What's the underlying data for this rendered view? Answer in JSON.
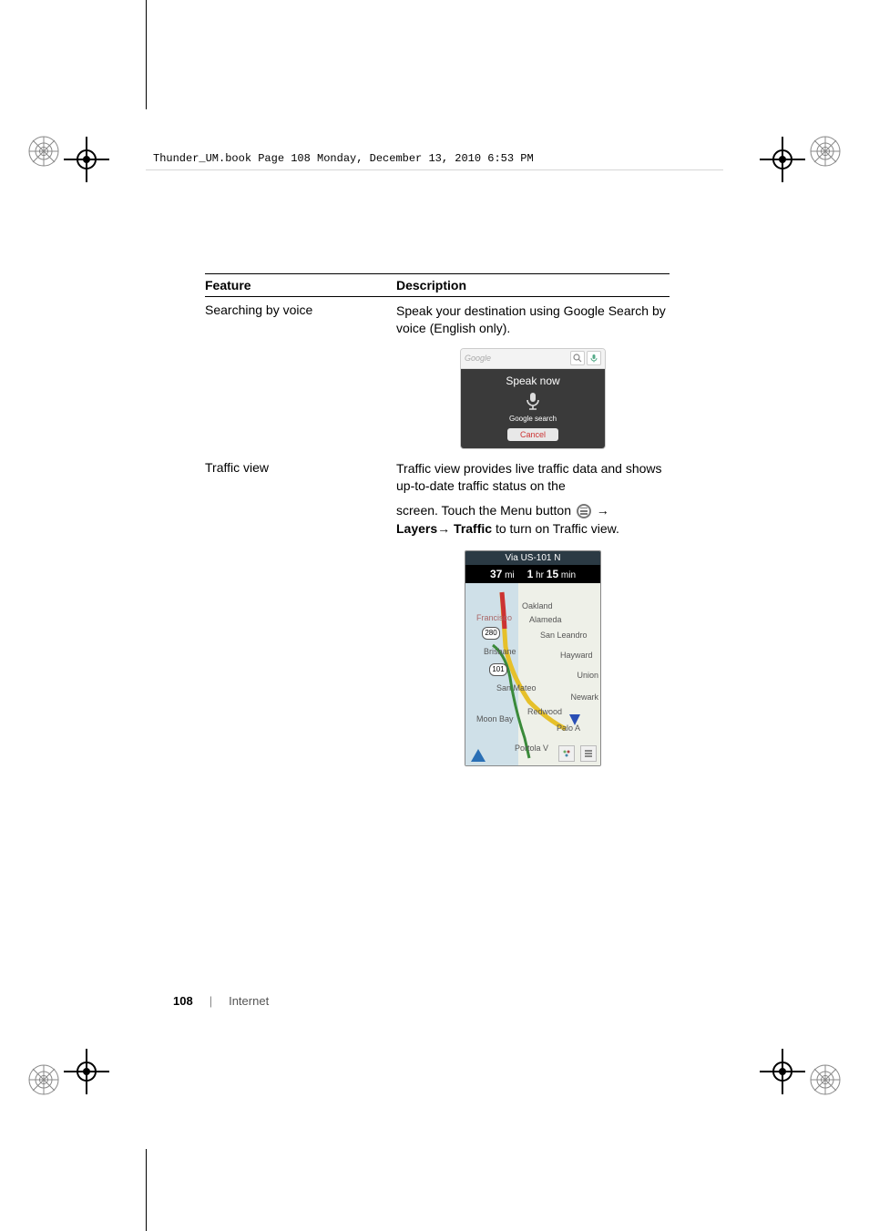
{
  "running_header": "Thunder_UM.book  Page 108  Monday, December 13, 2010  6:53 PM",
  "table": {
    "head_feature": "Feature",
    "head_desc": "Description",
    "rows": [
      {
        "feature": "Searching by voice",
        "desc_line1": "Speak your destination using Google Search by voice (English only).",
        "voice": {
          "placeholder": "Google",
          "title": "Speak now",
          "subtitle": "Google search",
          "cancel": "Cancel"
        }
      },
      {
        "feature": "Traffic view",
        "desc_line1": "Traffic view provides live traffic data and shows up-to-date traffic status on the",
        "desc_line2_prefix": "screen. Touch the Menu button ",
        "desc_line2_suffix": "→",
        "desc_line3_layers": "Layers",
        "desc_line3_arrow": "→ ",
        "desc_line3_traffic": "Traffic",
        "desc_line3_suffix": " to turn on Traffic view.",
        "traffic": {
          "via": "Via US-101 N",
          "miles_val": "37",
          "miles_unit": " mi",
          "hr_val": "1",
          "hr_unit": " hr ",
          "min_val": "15",
          "min_unit": " min",
          "labels": {
            "oakland": "Oakland",
            "alameda": "Alameda",
            "sf": "Francisco",
            "sanleandro": "San Leandro",
            "hayward": "Hayward",
            "union": "Union",
            "newark": "Newark",
            "sanmateo": "San Mateo",
            "brisbane": "Brisbane",
            "moonbay": "Moon Bay",
            "redwood": "Redwood",
            "palo": "Palo A",
            "portola": "Portola V",
            "shield280": "280",
            "shield101": "101"
          }
        }
      }
    ]
  },
  "footer": {
    "page": "108",
    "section": "Internet"
  }
}
